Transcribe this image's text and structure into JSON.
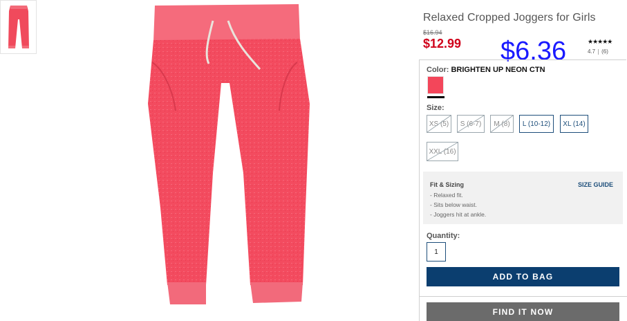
{
  "product": {
    "title": "Relaxed Cropped Joggers for Girls",
    "old_price": "$16.94",
    "price": "$12.99",
    "overlay_price": "$6.36",
    "rating": {
      "stars": "★★★★★",
      "score": "4.7",
      "count": "(6)"
    }
  },
  "color": {
    "label": "Color:",
    "value": "BRIGHTEN UP NEON CTN",
    "swatch_hex": "#f3465a"
  },
  "size": {
    "label": "Size:",
    "options": [
      {
        "label": "XS (5)",
        "available": false
      },
      {
        "label": "S (6-7)",
        "available": false
      },
      {
        "label": "M (8)",
        "available": false
      },
      {
        "label": "L (10-12)",
        "available": true
      },
      {
        "label": "XL (14)",
        "available": true
      },
      {
        "label": "XXL (16)",
        "available": false
      }
    ]
  },
  "fit": {
    "title": "Fit & Sizing",
    "guide_link": "SIZE GUIDE",
    "items": [
      "- Relaxed fit.",
      "- Sits below waist.",
      "- Joggers hit at ankle."
    ]
  },
  "quantity": {
    "label": "Quantity:",
    "value": "1"
  },
  "buttons": {
    "add_to_bag": "ADD TO BAG",
    "find_it_now": "FIND IT NOW"
  },
  "colors": {
    "accent": "#0b3e6f",
    "sale": "#d0021b",
    "product": "#f3465a"
  }
}
